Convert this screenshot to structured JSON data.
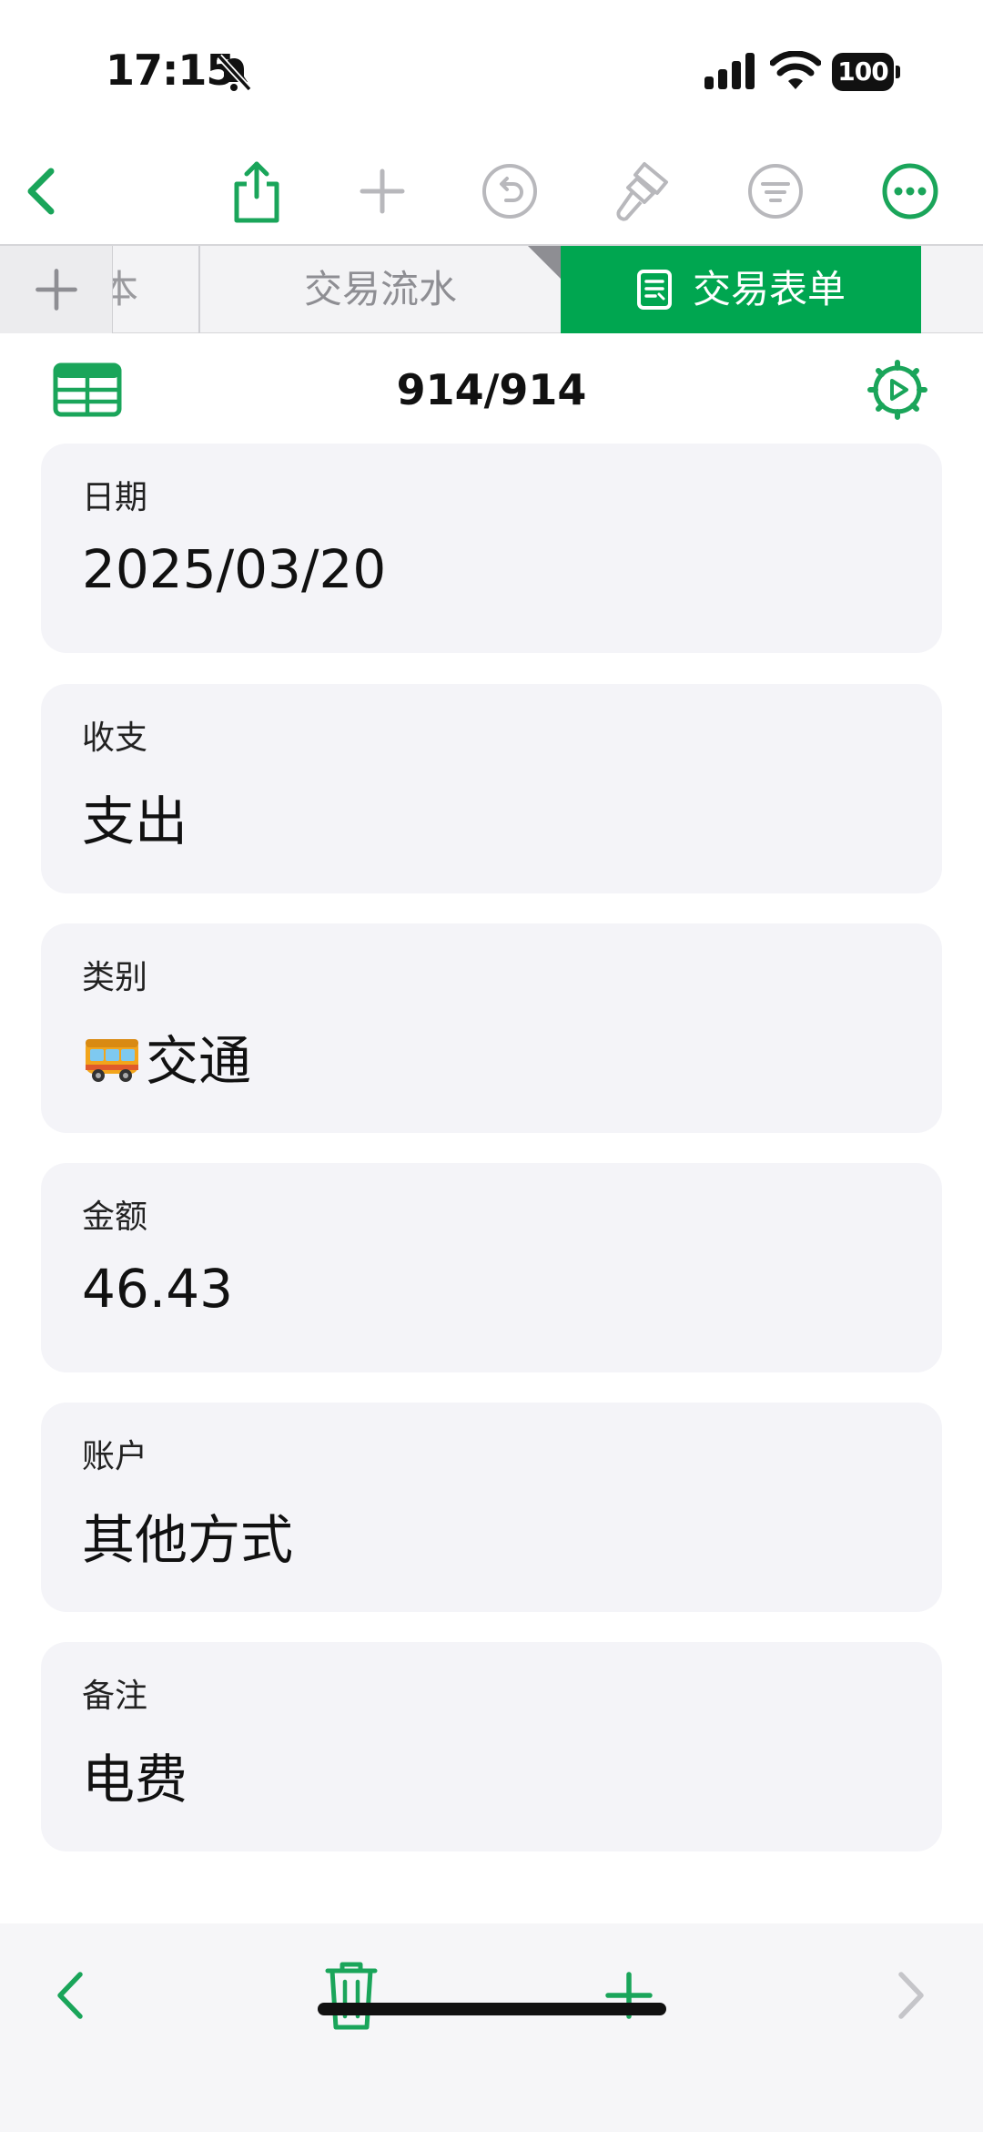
{
  "status_bar": {
    "time": "17:15",
    "battery": "100"
  },
  "toolbar": {
    "accent_color": "#1aa55a"
  },
  "tabs": {
    "partial_label": "本",
    "items": [
      {
        "label": "交易流水",
        "active": false
      },
      {
        "label": "交易表单",
        "active": true
      }
    ]
  },
  "record": {
    "counter": "914/914"
  },
  "form": {
    "fields": [
      {
        "label": "日期",
        "value": "2025/03/20"
      },
      {
        "label": "收支",
        "value": "支出"
      },
      {
        "label": "类别",
        "value": "交通",
        "emoji": "bus-icon"
      },
      {
        "label": "金额",
        "value": "46.43"
      },
      {
        "label": "账户",
        "value": "其他方式"
      },
      {
        "label": "备注",
        "value": "电费"
      }
    ]
  }
}
